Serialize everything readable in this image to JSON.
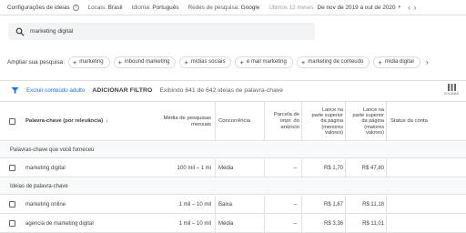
{
  "topbar": {
    "title": "Configurações de ideias",
    "help_glyph": "?",
    "locations_label": "Locais:",
    "locations_value": "Brasil",
    "language_label": "Idioma:",
    "language_value": "Português",
    "network_label": "Redes de pesquisa:",
    "network_value": "Google",
    "period_label": "Últimos 12 meses",
    "period_range": "De nov de 2019 a out de 2020",
    "caret": "▾",
    "prev": "‹",
    "next": "›"
  },
  "search": {
    "value": "marketing digital",
    "icon": "search-icon"
  },
  "expand": {
    "label": "Ampliar sua pesquisa:",
    "chips": [
      "marketing",
      "inbound marketing",
      "mídias sociais",
      "e mail marketing",
      "marketing de conteudo",
      "mídia digital"
    ],
    "plus": "+",
    "next": "›"
  },
  "filterbar": {
    "icon": "funnel-icon",
    "exclude_link": "Excluir conteúdo adulto",
    "add_filter": "ADICIONAR FILTRO",
    "count": "Exibindo 641 de 642 ideias de palavra-chave",
    "columns_label": "COLUNAS",
    "columns_icon": "columns-icon"
  },
  "table": {
    "headers": {
      "keyword": "Palavra-chave (por relevância)",
      "sort_arrow": "↓",
      "avg": [
        "Média de pesquisas",
        "mensais"
      ],
      "competition": "Concorrência",
      "impr_share": [
        "Parcela de",
        "impr. do",
        "anúncio"
      ],
      "bid_low": [
        "Lance na",
        "parte superior",
        "da página",
        "(menores",
        "valores)"
      ],
      "bid_high": [
        "Lance na",
        "parte superior",
        "da página",
        "(maiores",
        "valores)"
      ],
      "status": "Status da conta"
    },
    "group_provided": "Palavras-chave que você forneceu",
    "group_ideas": "Ideias de palavra-chave",
    "provided_rows": [
      {
        "keyword": "marketing digital",
        "avg": "100 mil – 1 mi",
        "competition": "Média",
        "impr": "–",
        "low": "R$ 1,70",
        "high": "R$ 47,80"
      }
    ],
    "idea_rows": [
      {
        "keyword": "marketing online",
        "avg": "1 mil – 10 mil",
        "competition": "Baixa",
        "impr": "–",
        "low": "R$ 1,87",
        "high": "R$ 11,18"
      },
      {
        "keyword": "agencia de marketing digital",
        "avg": "1 mil – 10 mil",
        "competition": "Média",
        "impr": "–",
        "low": "R$ 3,36",
        "high": "R$ 11,01"
      }
    ]
  }
}
